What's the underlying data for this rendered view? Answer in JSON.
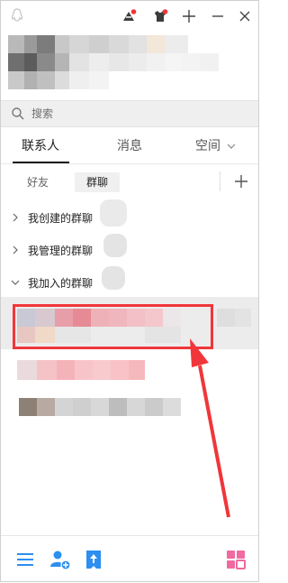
{
  "search": {
    "placeholder": "搜索"
  },
  "tabs": [
    {
      "label": "联系人",
      "active": true
    },
    {
      "label": "消息",
      "active": false
    },
    {
      "label": "空间",
      "active": false
    }
  ],
  "subtabs": [
    {
      "label": "好友",
      "active": false
    },
    {
      "label": "群聊",
      "active": true
    }
  ],
  "groups": [
    {
      "label": "我创建的群聊",
      "expanded": false
    },
    {
      "label": "我管理的群聊",
      "expanded": false
    },
    {
      "label": "我加入的群聊",
      "expanded": true
    }
  ],
  "icons": {
    "logo": "qq-penguin-icon",
    "skin": "skin-icon",
    "shirt": "shirt-icon",
    "add": "plus-icon",
    "minimize": "minimize-icon",
    "close": "close-icon",
    "search": "search-icon",
    "chevron": "chevron-icon",
    "menu": "menu-icon",
    "add_contact": "add-contact-icon",
    "upload": "upload-icon",
    "app_grid": "app-grid-icon"
  },
  "colors": {
    "highlight_border": "#f0363a",
    "arrow": "#f0363a",
    "tab_active": "#1a1a1a",
    "accent_blue": "#2d8ff0",
    "grid_pink": "#f06aa0"
  }
}
